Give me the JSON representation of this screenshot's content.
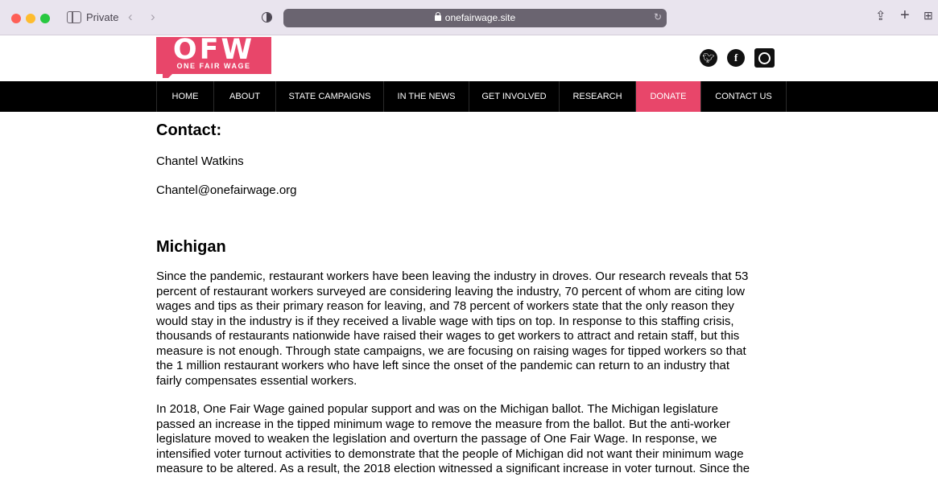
{
  "browser": {
    "private_label": "Private",
    "url": "onefairwage.site",
    "icons": [
      "sidebar-icon",
      "back-arrow-icon",
      "forward-arrow-icon",
      "privacy-shield-icon",
      "lock-icon",
      "reload-icon",
      "share-icon",
      "new-tab-icon",
      "tab-overview-icon"
    ]
  },
  "header": {
    "logo_text": "OFW",
    "logo_subtext": "ONE FAIR WAGE",
    "brand_color": "#e8466a",
    "social": [
      "twitter-icon",
      "facebook-icon",
      "instagram-icon"
    ]
  },
  "nav": {
    "items": [
      {
        "label": "HOME"
      },
      {
        "label": "ABOUT"
      },
      {
        "label": "STATE CAMPAIGNS"
      },
      {
        "label": "IN THE NEWS"
      },
      {
        "label": "GET INVOLVED"
      },
      {
        "label": "RESEARCH"
      },
      {
        "label": "DONATE",
        "highlight": true
      },
      {
        "label": "CONTACT US"
      }
    ]
  },
  "contact": {
    "heading": "Contact:",
    "name": "Chantel Watkins",
    "email": "Chantel@onefairwage.org"
  },
  "michigan": {
    "heading": "Michigan",
    "para1": [
      "Since the pandemic, restaurant workers have been leaving the industry in droves. Our research reveals that 53",
      "percent of restaurant workers surveyed are considering leaving the industry, 70 percent of whom are citing low",
      "wages and tips as their primary reason for leaving, and 78 percent of workers state that the only reason they",
      "would stay in the industry is if they received a livable wage with tips on top. In response to this staffing crisis,",
      "thousands of restaurants nationwide have raised their wages to get workers to attract and retain staff, but this",
      "measure is not enough. Through state campaigns, we are focusing on raising wages for tipped workers so that",
      "the 1 million restaurant workers who have left since the onset of the pandemic can return to an industry that",
      "fairly compensates essential workers."
    ],
    "para2": [
      "In 2018, One Fair Wage gained popular support and was on the Michigan ballot. The Michigan legislature",
      "passed an increase in the tipped minimum wage to remove the measure from the ballot. But the anti-worker",
      "legislature moved to weaken the legislation and overturn the passage of One Fair Wage. In response, we",
      "intensified voter turnout activities to demonstrate that the people of Michigan did not want their minimum wage",
      "measure to be altered. As a result, the 2018 election witnessed a significant increase in voter turnout. Since the"
    ]
  }
}
